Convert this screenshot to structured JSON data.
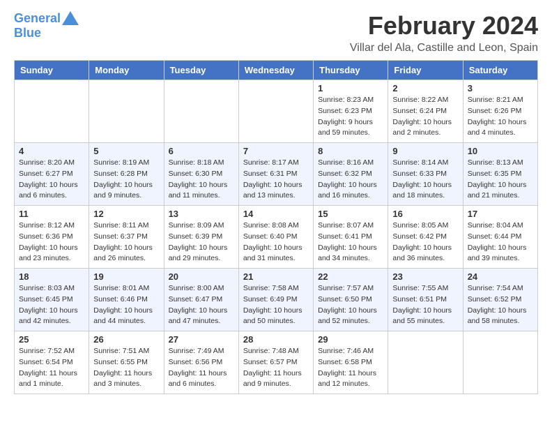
{
  "header": {
    "logo_line1": "General",
    "logo_line2": "Blue",
    "month_title": "February 2024",
    "location": "Villar del Ala, Castille and Leon, Spain"
  },
  "weekdays": [
    "Sunday",
    "Monday",
    "Tuesday",
    "Wednesday",
    "Thursday",
    "Friday",
    "Saturday"
  ],
  "weeks": [
    [
      {
        "day": "",
        "info": ""
      },
      {
        "day": "",
        "info": ""
      },
      {
        "day": "",
        "info": ""
      },
      {
        "day": "",
        "info": ""
      },
      {
        "day": "1",
        "info": "Sunrise: 8:23 AM\nSunset: 6:23 PM\nDaylight: 9 hours\nand 59 minutes."
      },
      {
        "day": "2",
        "info": "Sunrise: 8:22 AM\nSunset: 6:24 PM\nDaylight: 10 hours\nand 2 minutes."
      },
      {
        "day": "3",
        "info": "Sunrise: 8:21 AM\nSunset: 6:26 PM\nDaylight: 10 hours\nand 4 minutes."
      }
    ],
    [
      {
        "day": "4",
        "info": "Sunrise: 8:20 AM\nSunset: 6:27 PM\nDaylight: 10 hours\nand 6 minutes."
      },
      {
        "day": "5",
        "info": "Sunrise: 8:19 AM\nSunset: 6:28 PM\nDaylight: 10 hours\nand 9 minutes."
      },
      {
        "day": "6",
        "info": "Sunrise: 8:18 AM\nSunset: 6:30 PM\nDaylight: 10 hours\nand 11 minutes."
      },
      {
        "day": "7",
        "info": "Sunrise: 8:17 AM\nSunset: 6:31 PM\nDaylight: 10 hours\nand 13 minutes."
      },
      {
        "day": "8",
        "info": "Sunrise: 8:16 AM\nSunset: 6:32 PM\nDaylight: 10 hours\nand 16 minutes."
      },
      {
        "day": "9",
        "info": "Sunrise: 8:14 AM\nSunset: 6:33 PM\nDaylight: 10 hours\nand 18 minutes."
      },
      {
        "day": "10",
        "info": "Sunrise: 8:13 AM\nSunset: 6:35 PM\nDaylight: 10 hours\nand 21 minutes."
      }
    ],
    [
      {
        "day": "11",
        "info": "Sunrise: 8:12 AM\nSunset: 6:36 PM\nDaylight: 10 hours\nand 23 minutes."
      },
      {
        "day": "12",
        "info": "Sunrise: 8:11 AM\nSunset: 6:37 PM\nDaylight: 10 hours\nand 26 minutes."
      },
      {
        "day": "13",
        "info": "Sunrise: 8:09 AM\nSunset: 6:39 PM\nDaylight: 10 hours\nand 29 minutes."
      },
      {
        "day": "14",
        "info": "Sunrise: 8:08 AM\nSunset: 6:40 PM\nDaylight: 10 hours\nand 31 minutes."
      },
      {
        "day": "15",
        "info": "Sunrise: 8:07 AM\nSunset: 6:41 PM\nDaylight: 10 hours\nand 34 minutes."
      },
      {
        "day": "16",
        "info": "Sunrise: 8:05 AM\nSunset: 6:42 PM\nDaylight: 10 hours\nand 36 minutes."
      },
      {
        "day": "17",
        "info": "Sunrise: 8:04 AM\nSunset: 6:44 PM\nDaylight: 10 hours\nand 39 minutes."
      }
    ],
    [
      {
        "day": "18",
        "info": "Sunrise: 8:03 AM\nSunset: 6:45 PM\nDaylight: 10 hours\nand 42 minutes."
      },
      {
        "day": "19",
        "info": "Sunrise: 8:01 AM\nSunset: 6:46 PM\nDaylight: 10 hours\nand 44 minutes."
      },
      {
        "day": "20",
        "info": "Sunrise: 8:00 AM\nSunset: 6:47 PM\nDaylight: 10 hours\nand 47 minutes."
      },
      {
        "day": "21",
        "info": "Sunrise: 7:58 AM\nSunset: 6:49 PM\nDaylight: 10 hours\nand 50 minutes."
      },
      {
        "day": "22",
        "info": "Sunrise: 7:57 AM\nSunset: 6:50 PM\nDaylight: 10 hours\nand 52 minutes."
      },
      {
        "day": "23",
        "info": "Sunrise: 7:55 AM\nSunset: 6:51 PM\nDaylight: 10 hours\nand 55 minutes."
      },
      {
        "day": "24",
        "info": "Sunrise: 7:54 AM\nSunset: 6:52 PM\nDaylight: 10 hours\nand 58 minutes."
      }
    ],
    [
      {
        "day": "25",
        "info": "Sunrise: 7:52 AM\nSunset: 6:54 PM\nDaylight: 11 hours\nand 1 minute."
      },
      {
        "day": "26",
        "info": "Sunrise: 7:51 AM\nSunset: 6:55 PM\nDaylight: 11 hours\nand 3 minutes."
      },
      {
        "day": "27",
        "info": "Sunrise: 7:49 AM\nSunset: 6:56 PM\nDaylight: 11 hours\nand 6 minutes."
      },
      {
        "day": "28",
        "info": "Sunrise: 7:48 AM\nSunset: 6:57 PM\nDaylight: 11 hours\nand 9 minutes."
      },
      {
        "day": "29",
        "info": "Sunrise: 7:46 AM\nSunset: 6:58 PM\nDaylight: 11 hours\nand 12 minutes."
      },
      {
        "day": "",
        "info": ""
      },
      {
        "day": "",
        "info": ""
      }
    ]
  ]
}
